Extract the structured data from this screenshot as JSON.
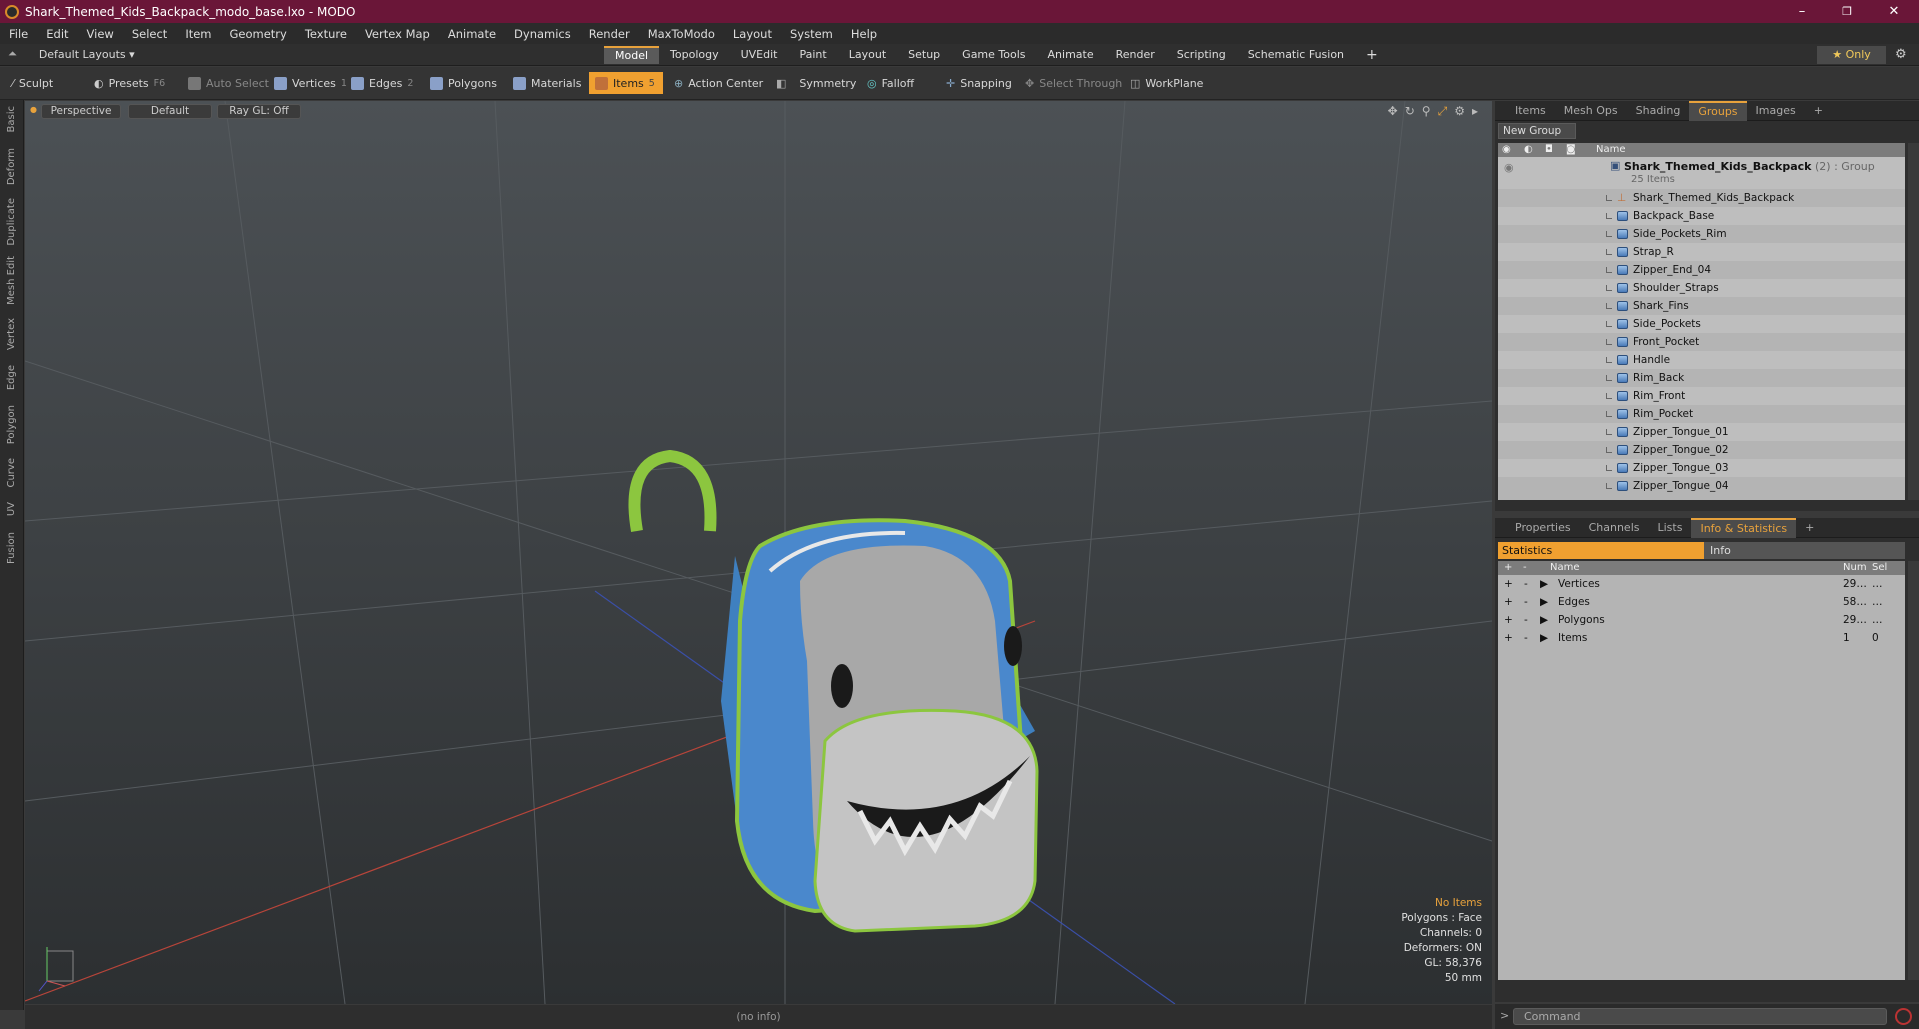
{
  "window": {
    "title": "Shark_Themed_Kids_Backpack_modo_base.lxo - MODO",
    "minimize": "–",
    "maximize": "❐",
    "close": "✕"
  },
  "menu": [
    "File",
    "Edit",
    "View",
    "Select",
    "Item",
    "Geometry",
    "Texture",
    "Vertex Map",
    "Animate",
    "Dynamics",
    "Render",
    "MaxToModo",
    "Layout",
    "System",
    "Help"
  ],
  "layout_bar": {
    "layouts_label": "Default Layouts ▾",
    "tabs": [
      "Model",
      "Topology",
      "UVEdit",
      "Paint",
      "Layout",
      "Setup",
      "Game Tools",
      "Animate",
      "Render",
      "Scripting",
      "Schematic Fusion"
    ],
    "active_tab": "Model",
    "add": "+",
    "only_label": "★ Only"
  },
  "toolbar": {
    "sculpt": "Sculpt",
    "presets": "Presets",
    "presets_key": "F6",
    "auto_select": "Auto Select",
    "vertices": "Vertices",
    "vertices_key": "1",
    "edges": "Edges",
    "edges_key": "2",
    "polygons": "Polygons",
    "materials": "Materials",
    "items": "Items",
    "items_key": "5",
    "action_center": "Action Center",
    "symmetry": "Symmetry",
    "falloff": "Falloff",
    "snapping": "Snapping",
    "select_through": "Select Through",
    "workplane": "WorkPlane"
  },
  "left_tabs": [
    "Basic",
    "Deform",
    "Duplicate",
    "Mesh Edit",
    "Vertex",
    "Edge",
    "Polygon",
    "Curve",
    "UV",
    "Fusion"
  ],
  "viewport": {
    "view_mode": "Perspective",
    "shading": "Default",
    "raygl": "Ray GL: Off",
    "info": {
      "selection": "No Items",
      "polygons": "Polygons : Face",
      "channels": "Channels: 0",
      "deformers": "Deformers: ON",
      "gl": "GL: 58,376",
      "lens": "50 mm"
    }
  },
  "status_text": "(no info)",
  "items_panel": {
    "tabs": [
      "Items",
      "Mesh Ops",
      "Shading",
      "Groups",
      "Images",
      "+"
    ],
    "active_tab": "Groups",
    "new_group": "New Group",
    "column_name": "Name",
    "group": {
      "name": "Shark_Themed_Kids_Backpack",
      "suffix": " (2) : Group",
      "count": "25 Items"
    },
    "rows": [
      "Shark_Themed_Kids_Backpack",
      "Backpack_Base",
      "Side_Pockets_Rim",
      "Strap_R",
      "Zipper_End_04",
      "Shoulder_Straps",
      "Shark_Fins",
      "Side_Pockets",
      "Front_Pocket",
      "Handle",
      "Rim_Back",
      "Rim_Front",
      "Rim_Pocket",
      "Zipper_Tongue_01",
      "Zipper_Tongue_02",
      "Zipper_Tongue_03",
      "Zipper_Tongue_04"
    ]
  },
  "stats_panel": {
    "tabs": [
      "Properties",
      "Channels",
      "Lists",
      "Info & Statistics",
      "+"
    ],
    "active_tab": "Info & Statistics",
    "statistics": "Statistics",
    "info": "Info",
    "columns": {
      "name": "Name",
      "num": "Num",
      "sel": "Sel"
    },
    "rows": [
      {
        "name": "Vertices",
        "num": "29…",
        "sel": "…"
      },
      {
        "name": "Edges",
        "num": "58…",
        "sel": "…"
      },
      {
        "name": "Polygons",
        "num": "29…",
        "sel": "…"
      },
      {
        "name": "Items",
        "num": "1",
        "sel": "0"
      }
    ]
  },
  "command": {
    "prompt": ">",
    "placeholder": "Command"
  },
  "colors": {
    "title_bar": "#6a1638",
    "accent": "#e8a23c",
    "items_active": "#f0a030"
  }
}
